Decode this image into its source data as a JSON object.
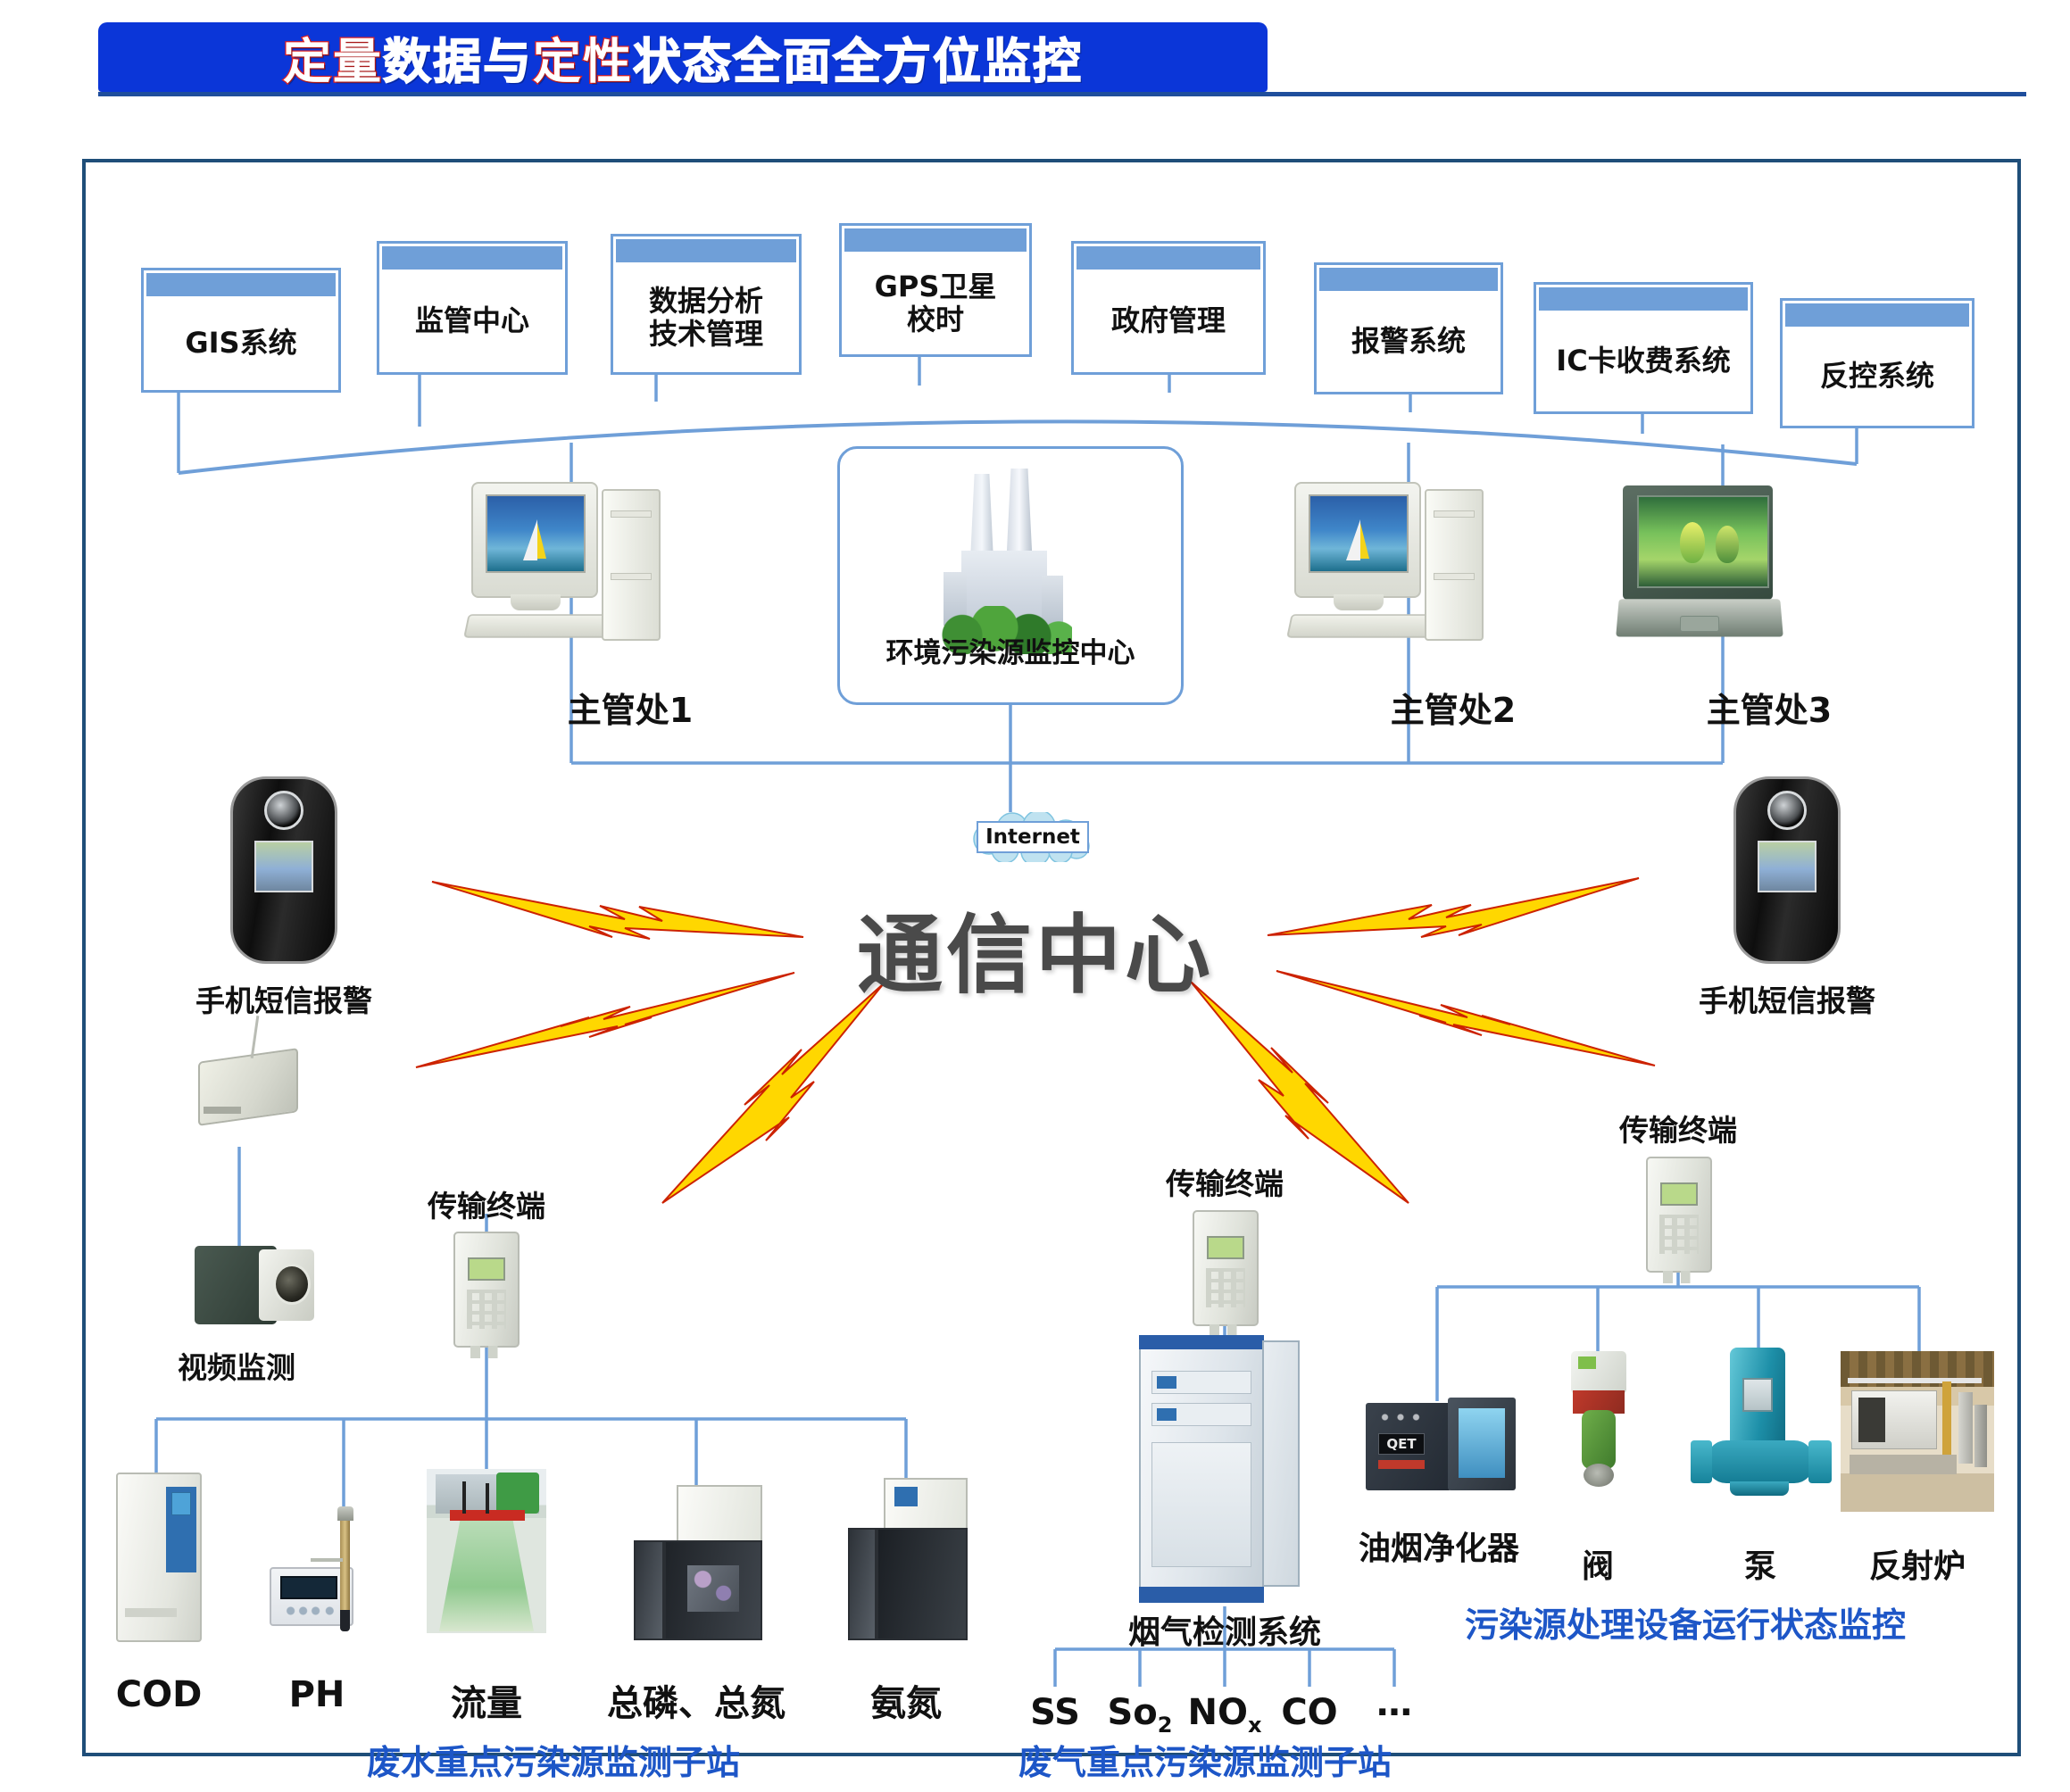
{
  "title": {
    "red_1": "定量",
    "black_1": "数据与",
    "red_2": "定性",
    "black_2": "状态全面全方位监控",
    "full": "定量数据与定性状态全面全方位监控"
  },
  "top_systems": [
    {
      "label": "GIS系统"
    },
    {
      "label": "监管中心"
    },
    {
      "label": "数据分析\n技术管理"
    },
    {
      "label": "GPS卫星\n校时"
    },
    {
      "label": "政府管理"
    },
    {
      "label": "报警系统"
    },
    {
      "label": "IC卡收费系统"
    },
    {
      "label": "反控系统"
    }
  ],
  "mid_tier": {
    "workstation_1": "主管处1",
    "center_box": "环境污染源监控中心",
    "workstation_2": "主管处2",
    "workstation_3": "主管处3"
  },
  "network": {
    "internet": "Internet",
    "communication_center": "通信中心"
  },
  "left_branch": {
    "phone_alarm": "手机短信报警",
    "video_monitoring": "视频监测",
    "transmission_terminal": "传输终端"
  },
  "right_branch": {
    "phone_alarm": "手机短信报警",
    "transmission_terminal": "传输终端"
  },
  "wastewater_station": {
    "caption": "废水重点污染源监测子站",
    "sensors": [
      "COD",
      "PH",
      "流量",
      "总磷、总氮",
      "氨氮"
    ]
  },
  "waste_gas_station": {
    "caption": "废气重点污染源监测子站",
    "transmission_terminal": "传输终端",
    "system_label": "烟气检测系统",
    "analytes": [
      "SS",
      "So",
      "NO",
      "CO",
      "…"
    ],
    "analyte_full": [
      "SS",
      "So2",
      "NOx",
      "CO",
      "…"
    ],
    "analyte_subs": [
      "",
      "2",
      "x",
      "",
      ""
    ]
  },
  "equipment_monitoring": {
    "caption": "污染源处理设备运行状态监控",
    "transmission_terminal": "传输终端",
    "items": [
      "油烟净化器",
      "阀",
      "泵",
      "反射炉"
    ],
    "purifier_brand": "QET"
  },
  "colors": {
    "banner_blue": "#0b36d8",
    "frame_blue": "#1f4e79",
    "box_blue": "#6f9fd8",
    "line_blue": "#6f9fd8",
    "caption_blue": "#1d56c7",
    "bolt_yellow": "#FFD700",
    "bolt_outline": "#cc2200",
    "center_text_gray": "#4a4a4a"
  }
}
